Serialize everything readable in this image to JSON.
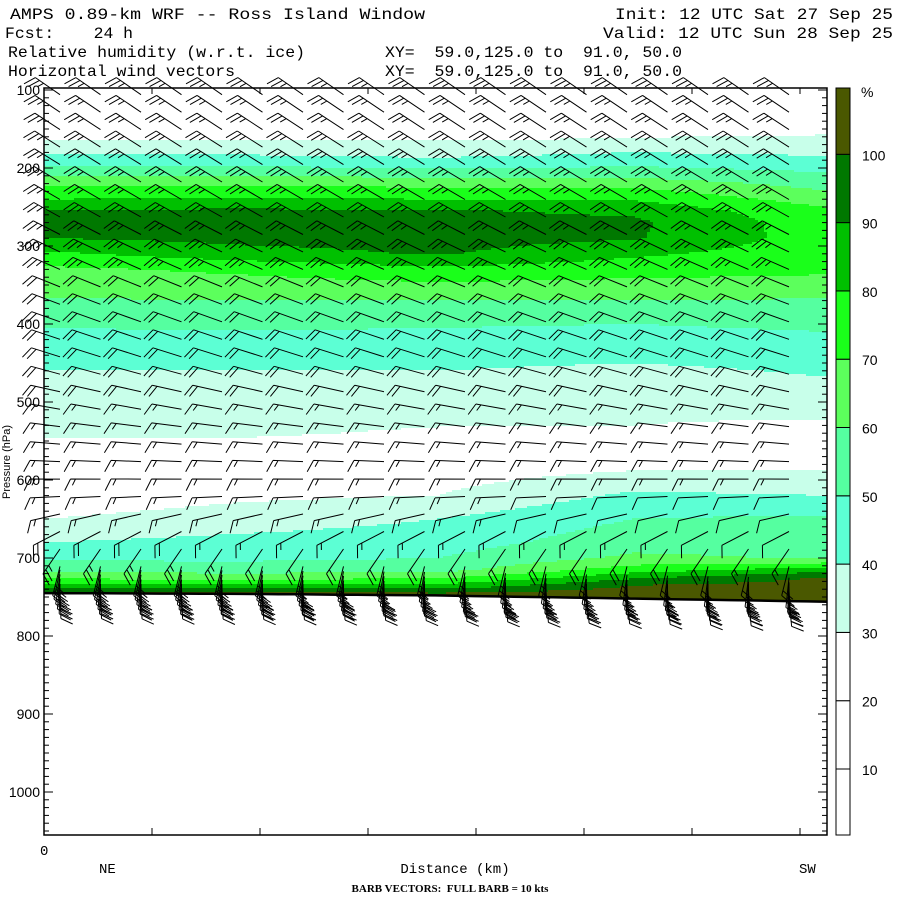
{
  "header": {
    "title": "AMPS 0.89-km WRF -- Ross Island Window",
    "init": "Init: 12 UTC Sat 27 Sep 25",
    "fcst": "Fcst:    24 h",
    "valid": "Valid: 12 UTC Sun 28 Sep 25",
    "field1": "Relative humidity (w.r.t. ice)",
    "field2": "Horizontal wind vectors",
    "xy1": "XY=  59.0,125.0 to  91.0, 50.0",
    "xy2": "XY=  59.0,125.0 to  91.0, 50.0"
  },
  "chart_data": {
    "type": "heatmap",
    "title": "Relative humidity (w.r.t. ice) and horizontal wind vectors cross-section",
    "xlabel": "Distance (km)",
    "x_start_label": "0",
    "x_left_end": "NE",
    "x_right_end": "SW",
    "ylabel": "Pressure (hPa)",
    "ylim": [
      1050,
      100
    ],
    "y_ticks": [
      "100",
      "200",
      "300",
      "400",
      "500",
      "600",
      "700",
      "800",
      "900",
      "1000"
    ],
    "footnote": "BARB VECTORS:  FULL BARB = 10 kts",
    "colorbar": {
      "unit": "%",
      "labels": [
        "10",
        "20",
        "30",
        "40",
        "50",
        "60",
        "70",
        "80",
        "90",
        "100"
      ],
      "thresholds": [
        10,
        20,
        30,
        40,
        50,
        60,
        70,
        80,
        90,
        100
      ],
      "colors": [
        "#ffffff",
        "#ffffff",
        "#ffffff",
        "#c8ffea",
        "#5cffd4",
        "#55ffa0",
        "#5cff5c",
        "#1aff1a",
        "#00c000",
        "#007800",
        "#4a5800"
      ]
    },
    "rh_levels_hpa": [
      100,
      150,
      165,
      180,
      195,
      210,
      225,
      240,
      255,
      270,
      290,
      310,
      330,
      350,
      370,
      400,
      430,
      460,
      500,
      540,
      580,
      620,
      650,
      680,
      700,
      715,
      725,
      735,
      745,
      760
    ],
    "rh_columns": [
      {
        "distance_fraction": 0.0,
        "rh": [
          10,
          25,
          30,
          38,
          48,
          60,
          72,
          80,
          91,
          93,
          90,
          78,
          68,
          64,
          59,
          51,
          45,
          40,
          35,
          31,
          25,
          23,
          30,
          40,
          48,
          57,
          67,
          85,
          105,
          105
        ]
      },
      {
        "distance_fraction": 0.25,
        "rh": [
          10,
          25,
          30,
          38,
          48,
          60,
          72,
          81,
          92,
          94,
          93,
          86,
          72,
          66,
          60,
          52,
          45,
          40,
          34,
          31,
          24,
          28,
          35,
          43,
          48,
          55,
          66,
          82,
          105,
          105
        ]
      },
      {
        "distance_fraction": 0.5,
        "rh": [
          10,
          25,
          30,
          36,
          45,
          58,
          70,
          80,
          91,
          94,
          94,
          91,
          78,
          68,
          60,
          51,
          45,
          40,
          34,
          29,
          24,
          30,
          40,
          45,
          50,
          56,
          68,
          82,
          100,
          105
        ]
      },
      {
        "distance_fraction": 0.75,
        "rh": [
          10,
          27,
          31,
          40,
          48,
          58,
          70,
          79,
          88,
          92,
          91,
          82,
          74,
          67,
          60,
          50,
          44,
          38,
          33,
          29,
          27,
          42,
          50,
          56,
          62,
          75,
          88,
          100,
          105,
          105
        ]
      },
      {
        "distance_fraction": 1.0,
        "rh": [
          10,
          27,
          33,
          38,
          45,
          52,
          58,
          65,
          72,
          74,
          75,
          74,
          72,
          66,
          59,
          52,
          46,
          41,
          36,
          25,
          28,
          40,
          52,
          56,
          59,
          85,
          101,
          104,
          105,
          105
        ]
      }
    ],
    "terrain_surface_pressure_hpa": [
      745,
      746,
      748,
      752,
      756
    ],
    "wind_profile": [
      {
        "p": 100,
        "dir_deg": 305,
        "speed_kt": 25
      },
      {
        "p": 250,
        "dir_deg": 300,
        "speed_kt": 25
      },
      {
        "p": 350,
        "dir_deg": 292,
        "speed_kt": 25
      },
      {
        "p": 450,
        "dir_deg": 287,
        "speed_kt": 22
      },
      {
        "p": 550,
        "dir_deg": 275,
        "speed_kt": 18
      },
      {
        "p": 620,
        "dir_deg": 268,
        "speed_kt": 15
      },
      {
        "p": 660,
        "dir_deg": 250,
        "speed_kt": 20
      },
      {
        "p": 700,
        "dir_deg": 200,
        "speed_kt": 30
      },
      {
        "p": 745,
        "dir_deg": 175,
        "speed_kt": 35
      },
      {
        "p": 760,
        "dir_deg": 175,
        "speed_kt": 35
      }
    ],
    "wind_barb_columns": 19
  }
}
